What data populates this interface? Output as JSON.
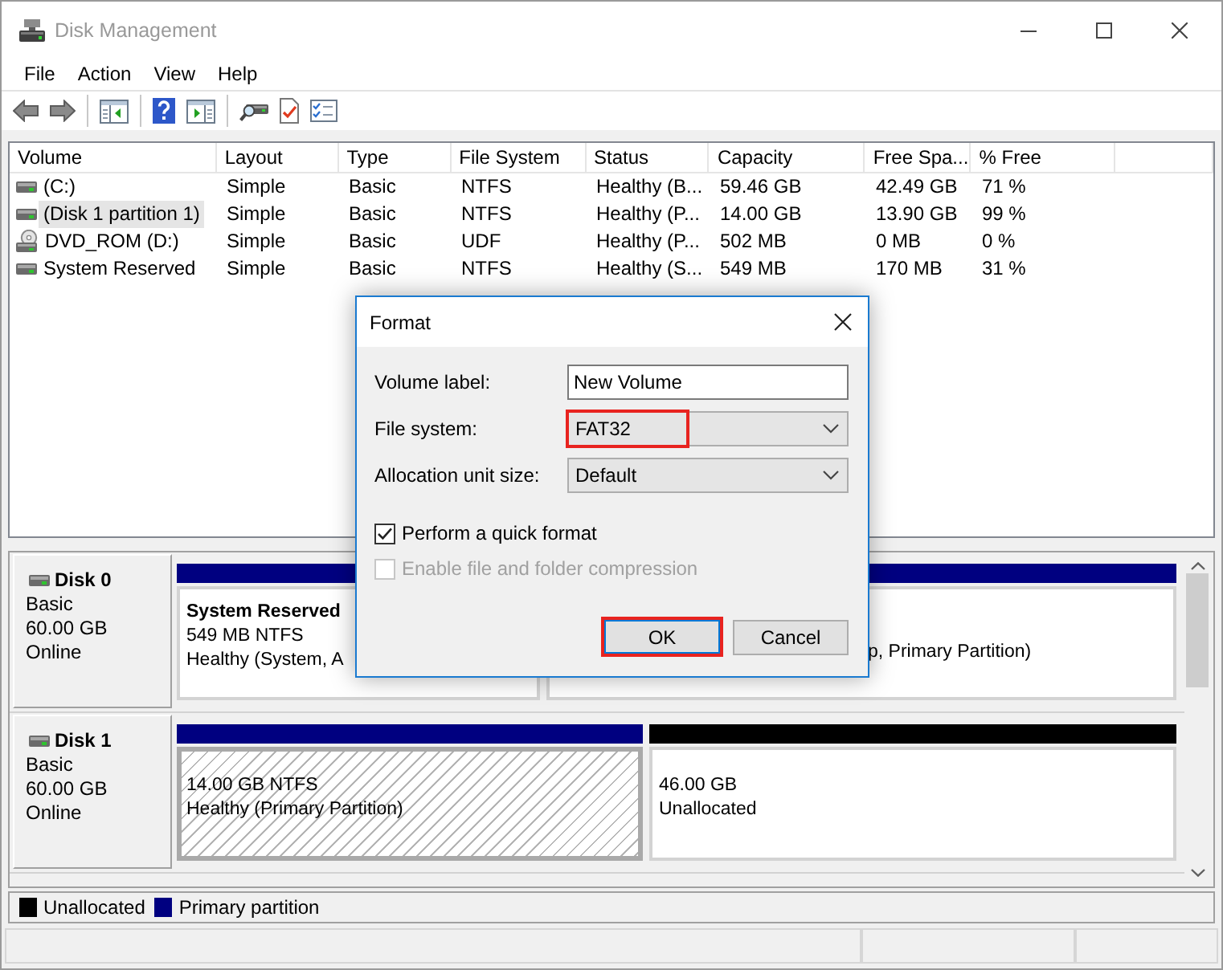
{
  "window": {
    "title": "Disk Management"
  },
  "menu": [
    {
      "label": "File"
    },
    {
      "label": "Action"
    },
    {
      "label": "View"
    },
    {
      "label": "Help"
    }
  ],
  "volume_table": {
    "columns": [
      "Volume",
      "Layout",
      "Type",
      "File System",
      "Status",
      "Capacity",
      "Free Spa...",
      "% Free"
    ],
    "rows": [
      {
        "kind": "disk",
        "selected": false,
        "cells": [
          "(C:)",
          "Simple",
          "Basic",
          "NTFS",
          "Healthy (B...",
          "59.46 GB",
          "42.49 GB",
          "71 %"
        ]
      },
      {
        "kind": "disk",
        "selected": true,
        "cells": [
          "(Disk 1 partition 1)",
          "Simple",
          "Basic",
          "NTFS",
          "Healthy (P...",
          "14.00 GB",
          "13.90 GB",
          "99 %"
        ]
      },
      {
        "kind": "optical",
        "selected": false,
        "cells": [
          "DVD_ROM (D:)",
          "Simple",
          "Basic",
          "UDF",
          "Healthy (P...",
          "502 MB",
          "0 MB",
          "0 %"
        ]
      },
      {
        "kind": "disk",
        "selected": false,
        "cells": [
          "System Reserved",
          "Simple",
          "Basic",
          "NTFS",
          "Healthy (S...",
          "549 MB",
          "170 MB",
          "31 %"
        ]
      }
    ]
  },
  "disks": [
    {
      "name": "Disk 0",
      "type": "Basic",
      "size": "60.00 GB",
      "state": "Online",
      "partitions": [
        {
          "kind": "primary",
          "selected": false,
          "name": "System Reserved",
          "size": "549 MB NTFS",
          "status": "Healthy (System, A"
        },
        {
          "kind": "primary",
          "selected": false,
          "status": "p, Primary Partition)"
        }
      ]
    },
    {
      "name": "Disk 1",
      "type": "Basic",
      "size": "60.00 GB",
      "state": "Online",
      "partitions": [
        {
          "kind": "primary",
          "selected": true,
          "size": "14.00 GB NTFS",
          "status": "Healthy (Primary Partition)"
        },
        {
          "kind": "unallocated",
          "selected": false,
          "size": "46.00 GB",
          "status": "Unallocated"
        }
      ]
    }
  ],
  "legend": [
    {
      "label": "Unallocated",
      "color": "#000000"
    },
    {
      "label": "Primary partition",
      "color": "#000080"
    }
  ],
  "format_dialog": {
    "title": "Format",
    "fields": [
      {
        "kind": "text",
        "label": "Volume label:",
        "value": "New Volume",
        "highlighted": false
      },
      {
        "kind": "dropdown",
        "label": "File system:",
        "value": "FAT32",
        "highlighted": true
      },
      {
        "kind": "dropdown",
        "label": "Allocation unit size:",
        "value": "Default",
        "highlighted": false
      }
    ],
    "options": [
      {
        "label": "Perform a quick format",
        "checked": true,
        "disabled": false
      },
      {
        "label": "Enable file and folder compression",
        "checked": false,
        "disabled": true
      }
    ],
    "buttons": [
      {
        "label": "OK",
        "default": true,
        "highlighted": true
      },
      {
        "label": "Cancel",
        "default": false,
        "highlighted": false
      }
    ]
  }
}
